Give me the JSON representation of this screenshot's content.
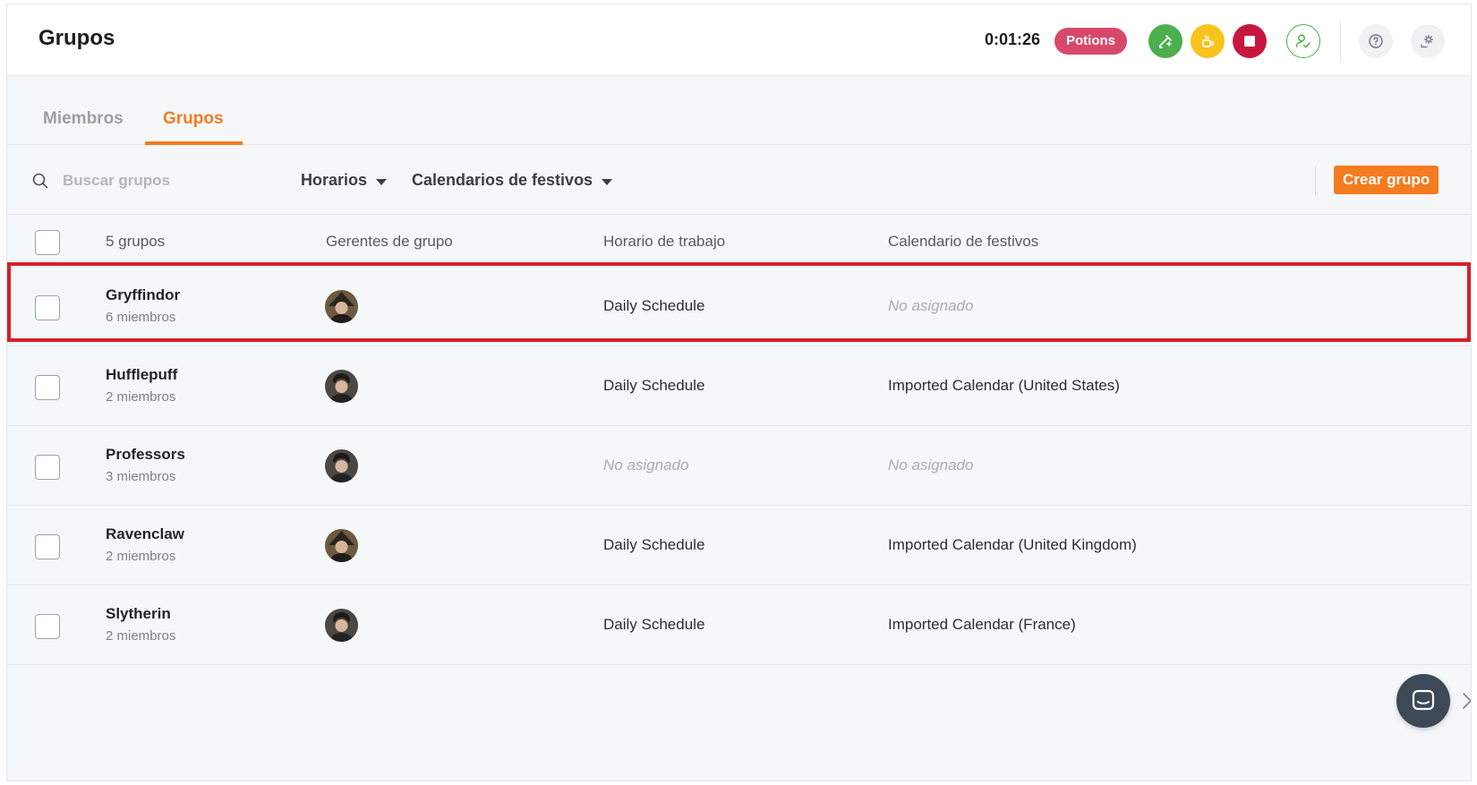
{
  "header": {
    "title": "Grupos",
    "timer": "0:01:26",
    "project": "Potions",
    "icons": [
      "edit-entry-icon",
      "break-icon",
      "stop-icon",
      "user-check-icon",
      "help-icon",
      "settings-icon"
    ],
    "colors": {
      "green": "#4cae4f",
      "yellow": "#f8c31c",
      "red": "#c8173f",
      "pill": "#d8486b"
    }
  },
  "tabs": [
    {
      "label": "Miembros",
      "active": false
    },
    {
      "label": "Grupos",
      "active": true
    }
  ],
  "toolbar": {
    "search_placeholder": "Buscar grupos",
    "filter_schedules": "Horarios",
    "filter_holidays": "Calendarios de festivos",
    "create_label": "Crear grupo",
    "accent": "#f47b20"
  },
  "table": {
    "headers": {
      "count": "5 grupos",
      "managers": "Gerentes de grupo",
      "schedule": "Horario de trabajo",
      "holiday": "Calendario de festivos"
    },
    "rows": [
      {
        "name": "Gryffindor",
        "members": "6 miembros",
        "schedule": "Daily Schedule",
        "holiday": "No asignado"
      },
      {
        "name": "Hufflepuff",
        "members": "2 miembros",
        "schedule": "Daily Schedule",
        "holiday": "Imported Calendar (United States)"
      },
      {
        "name": "Professors",
        "members": "3 miembros",
        "schedule": "No asignado",
        "holiday": "No asignado"
      },
      {
        "name": "Ravenclaw",
        "members": "2 miembros",
        "schedule": "Daily Schedule",
        "holiday": "Imported Calendar (United Kingdom)"
      },
      {
        "name": "Slytherin",
        "members": "2 miembros",
        "schedule": "Daily Schedule",
        "holiday": "Imported Calendar (France)"
      }
    ],
    "highlighted_row": "Gryffindor"
  }
}
